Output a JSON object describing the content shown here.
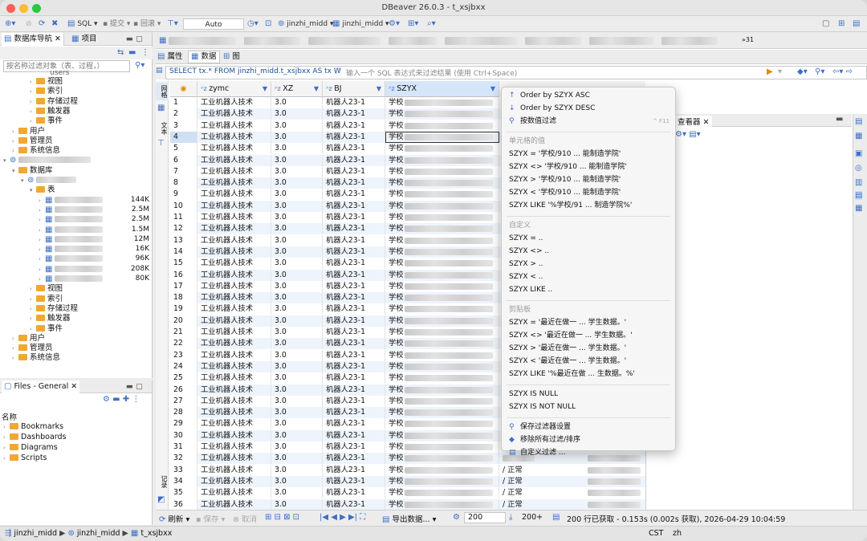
{
  "window": {
    "title": "DBeaver 26.0.3 - t_xsjbxx"
  },
  "toolbar": {
    "sql": "SQL",
    "commit": "提交",
    "rollback": "回滚",
    "auto": "Auto",
    "conn1": "jinzhi_midd",
    "conn2": "jinzhi_midd"
  },
  "nav": {
    "tab1": "数据库导航",
    "tab2": "项目",
    "search_placeholder": "按名称过滤对象（表、过程，）",
    "users": "users",
    "group1": [
      {
        "label": "视图",
        "indent": 1
      },
      {
        "label": "索引",
        "indent": 1
      },
      {
        "label": "存储过程",
        "indent": 1
      },
      {
        "label": "触发器",
        "indent": 1
      },
      {
        "label": "事件",
        "indent": 1
      }
    ],
    "group2": [
      {
        "label": "用户"
      },
      {
        "label": "管理员"
      },
      {
        "label": "系统信息"
      }
    ],
    "database": "数据库",
    "tables": "表",
    "sizes": [
      "144K",
      "2.5M",
      "2.5M",
      "1.5M",
      "12M",
      "16K",
      "96K",
      "208K",
      "80K"
    ],
    "group3": [
      {
        "label": "视图"
      },
      {
        "label": "索引"
      },
      {
        "label": "存储过程"
      },
      {
        "label": "触发器"
      },
      {
        "label": "事件"
      }
    ],
    "group4": [
      {
        "label": "用户"
      },
      {
        "label": "管理员"
      },
      {
        "label": "系统信息"
      }
    ]
  },
  "files": {
    "tab": "Files - General",
    "name_col": "名称",
    "items": [
      "Bookmarks",
      "Dashboards",
      "Diagrams",
      "Scripts"
    ]
  },
  "editor": {
    "sub_props": "属性",
    "sub_data": "数据",
    "sub_diagram": "图",
    "side_label1": "网格",
    "side_label2": "文本",
    "side_label3": "记录",
    "tab_extra": "31",
    "sql": "SELECT tx.* FROM jinzhi_midd.t_xsjbxx AS tx W",
    "filter_placeholder": "输入一个 SQL 表达式来过滤结果 (使用 Ctrl+Space)"
  },
  "grid": {
    "columns": [
      "zymc",
      "XZ",
      "BJ",
      "SZYX"
    ],
    "zymc": "工业机器人技术",
    "xz": "3.0",
    "bj": "机器人23-1",
    "szyx": "学校",
    "status": "正常"
  },
  "menu": {
    "items": [
      {
        "t": "item",
        "label": "Order by SZYX ASC",
        "icon": "arrow-up-icon"
      },
      {
        "t": "item",
        "label": "Order by SZYX DESC",
        "icon": "arrow-down-icon"
      },
      {
        "t": "item",
        "label": "按数值过滤",
        "icon": "filter-icon",
        "shortcut": "^ F11"
      },
      {
        "t": "sep"
      },
      {
        "t": "head",
        "label": "单元格的值"
      },
      {
        "t": "item",
        "label": "SZYX = '学校/910 ... 能制造学院'"
      },
      {
        "t": "item",
        "label": "SZYX <> '学校/910 ... 能制造学院'"
      },
      {
        "t": "item",
        "label": "SZYX > '学校/910 ... 能制造学院'"
      },
      {
        "t": "item",
        "label": "SZYX < '学校/910 ... 能制造学院'"
      },
      {
        "t": "item",
        "label": "SZYX LIKE '%学校/91 ... 制造学院%'"
      },
      {
        "t": "sep"
      },
      {
        "t": "head",
        "label": "自定义"
      },
      {
        "t": "item",
        "label": "SZYX = .."
      },
      {
        "t": "item",
        "label": "SZYX <> .."
      },
      {
        "t": "item",
        "label": "SZYX > .."
      },
      {
        "t": "item",
        "label": "SZYX < .."
      },
      {
        "t": "item",
        "label": "SZYX LIKE .."
      },
      {
        "t": "sep"
      },
      {
        "t": "head",
        "label": "剪贴板"
      },
      {
        "t": "item",
        "label": "SZYX = '最近在做一 ... 学生数据。'"
      },
      {
        "t": "item",
        "label": "SZYX <> '最近在做一 ... 学生数据。'"
      },
      {
        "t": "item",
        "label": "SZYX > '最近在做一 ... 学生数据。'"
      },
      {
        "t": "item",
        "label": "SZYX < '最近在做一 ... 学生数据。'"
      },
      {
        "t": "item",
        "label": "SZYX LIKE '%最近在做 ... 生数据。%'"
      },
      {
        "t": "sep"
      },
      {
        "t": "item",
        "label": "SZYX IS NULL"
      },
      {
        "t": "item",
        "label": "SZYX IS NOT NULL"
      },
      {
        "t": "sep"
      },
      {
        "t": "item",
        "label": "保存过滤器设置",
        "icon": "save-filter-icon"
      },
      {
        "t": "item",
        "label": "移除所有过滤/排序",
        "icon": "eraser-icon"
      },
      {
        "t": "item",
        "label": "自定义过滤 ...",
        "icon": "custom-filter-icon"
      }
    ]
  },
  "viewer": {
    "title": "查看器"
  },
  "bottom": {
    "refresh": "刷新",
    "save": "保存",
    "cancel": "取消",
    "export": "导出数据...",
    "fetch": "200",
    "fetch_more": "200+",
    "info": "200 行已获取 - 0.153s (0.002s 获取), 2026-04-29 10:04:59"
  },
  "status": {
    "crumb1": "jinzhi_midd",
    "crumb2": "jinzhi_midd",
    "crumb3": "t_xsjbxx",
    "tz": "CST",
    "lang": "zh"
  }
}
